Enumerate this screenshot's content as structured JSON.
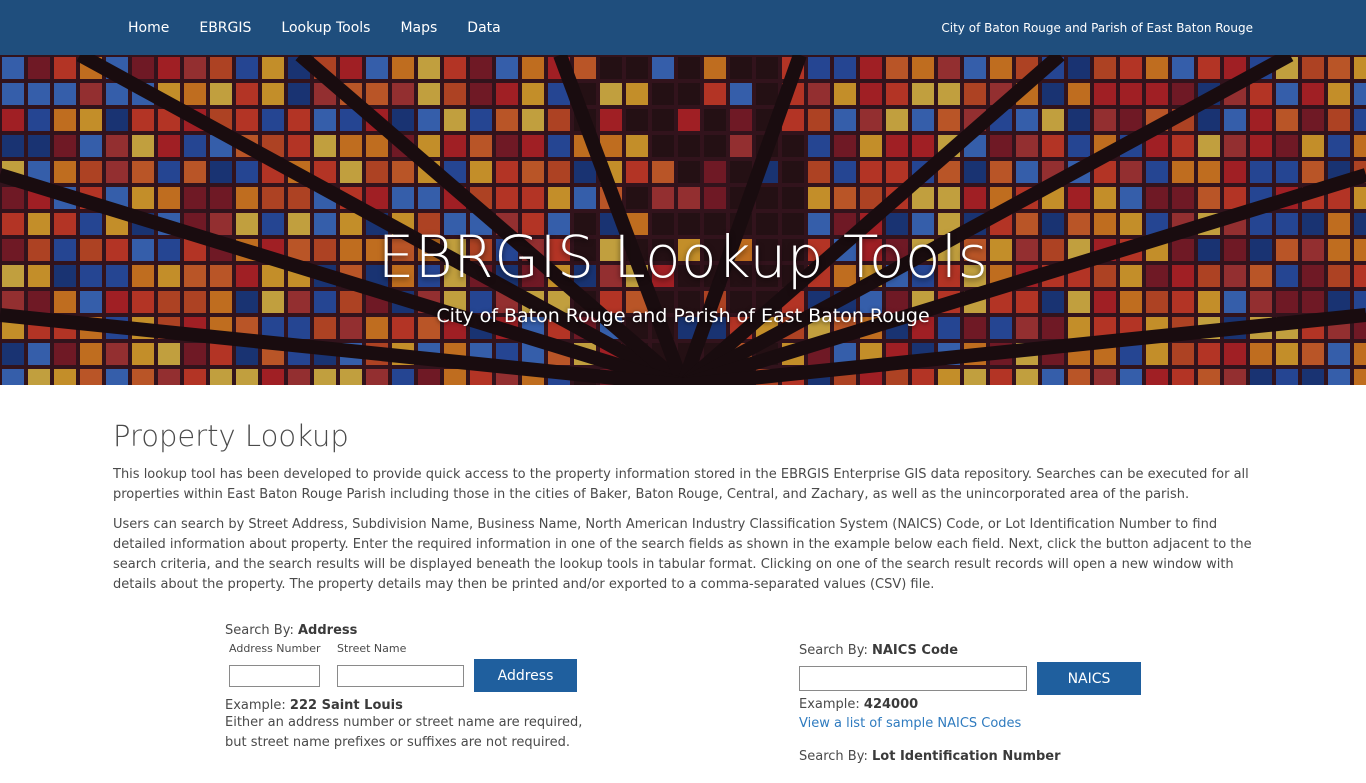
{
  "nav": {
    "items": [
      "Home",
      "EBRGIS",
      "Lookup Tools",
      "Maps",
      "Data"
    ],
    "site_name": "City of Baton Rouge and Parish of East Baton Rouge"
  },
  "hero": {
    "title": "EBRGIS Lookup Tools",
    "subtitle": "City of Baton Rouge and Parish of East Baton Rouge"
  },
  "main": {
    "title": "Property Lookup",
    "para1": "This lookup tool has been developed to provide quick access to the property information stored in the EBRGIS Enterprise GIS data repository. Searches can be executed for all properties within East Baton Rouge Parish including those in the cities of Baker, Baton Rouge, Central, and Zachary, as well as the unincorporated area of the parish.",
    "para2": "Users can search by Street Address, Subdivision Name, Business Name, North American Industry Classification System (NAICS) Code, or Lot Identification Number to find detailed information about property. Enter the required information in one of the search fields as shown in the example below each field. Next, click the button adjacent to the search criteria, and the search results will be displayed beneath the lookup tools in tabular format. Clicking on one of the search result records will open a new window with details about the property. The property details may then be printed and/or exported to a comma-separated values (CSV) file."
  },
  "address_search": {
    "search_by_prefix": "Search By:",
    "search_by_value": "Address",
    "number_label": "Address Number",
    "street_label": "Street Name",
    "number_value": "",
    "street_value": "",
    "button_label": "Address",
    "example_prefix": "Example:",
    "example_value": "222 Saint Louis",
    "note_line1": "Either an address number or street name are required,",
    "note_line2": "but street name prefixes or suffixes are not required."
  },
  "naics_search": {
    "search_by_prefix": "Search By:",
    "search_by_value": "NAICS Code",
    "input_value": "",
    "button_label": "NAICS",
    "example_prefix": "Example:",
    "example_value": "424000",
    "link_text": "View a list of sample NAICS Codes"
  },
  "lot_search": {
    "search_by_prefix": "Search By:",
    "search_by_value": "Lot Identification Number"
  },
  "colors": {
    "nav_bg": "#1f4e7d",
    "button_bg": "#1f5f9e",
    "link": "#2f7bbf"
  }
}
